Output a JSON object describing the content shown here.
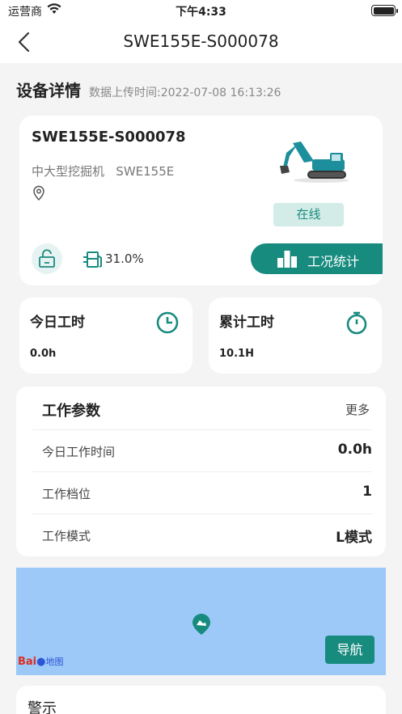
{
  "status_bar": {
    "carrier": "运营商",
    "time": "下午4:33"
  },
  "nav": {
    "title": "SWE155E-S000078"
  },
  "section": {
    "title": "设备详情",
    "upload_time": "数据上传时间:2022-07-08 16:13:26"
  },
  "device": {
    "model": "SWE155E-S000078",
    "type": "中大型挖掘机   SWE155E",
    "status": "在线",
    "fuel": "31.0%",
    "stats_button": "工况统计"
  },
  "hours": {
    "today_label": "今日工时",
    "today_value": "0.0h",
    "total_label": "累计工时",
    "total_value": "10.1H"
  },
  "params": {
    "title": "工作参数",
    "more": "更多",
    "rows": [
      {
        "key": "今日工作时间",
        "value": "0.0h"
      },
      {
        "key": "工作档位",
        "value": "1"
      },
      {
        "key": "工作模式",
        "value": "L模式"
      }
    ]
  },
  "map": {
    "nav_button": "导航",
    "logo_text": "Bai",
    "logo_text2": "地图"
  },
  "alert": {
    "title": "警示"
  },
  "colors": {
    "accent": "#188b7f",
    "badge_bg": "#d3ece8",
    "map_bg": "#9cc9f7"
  }
}
